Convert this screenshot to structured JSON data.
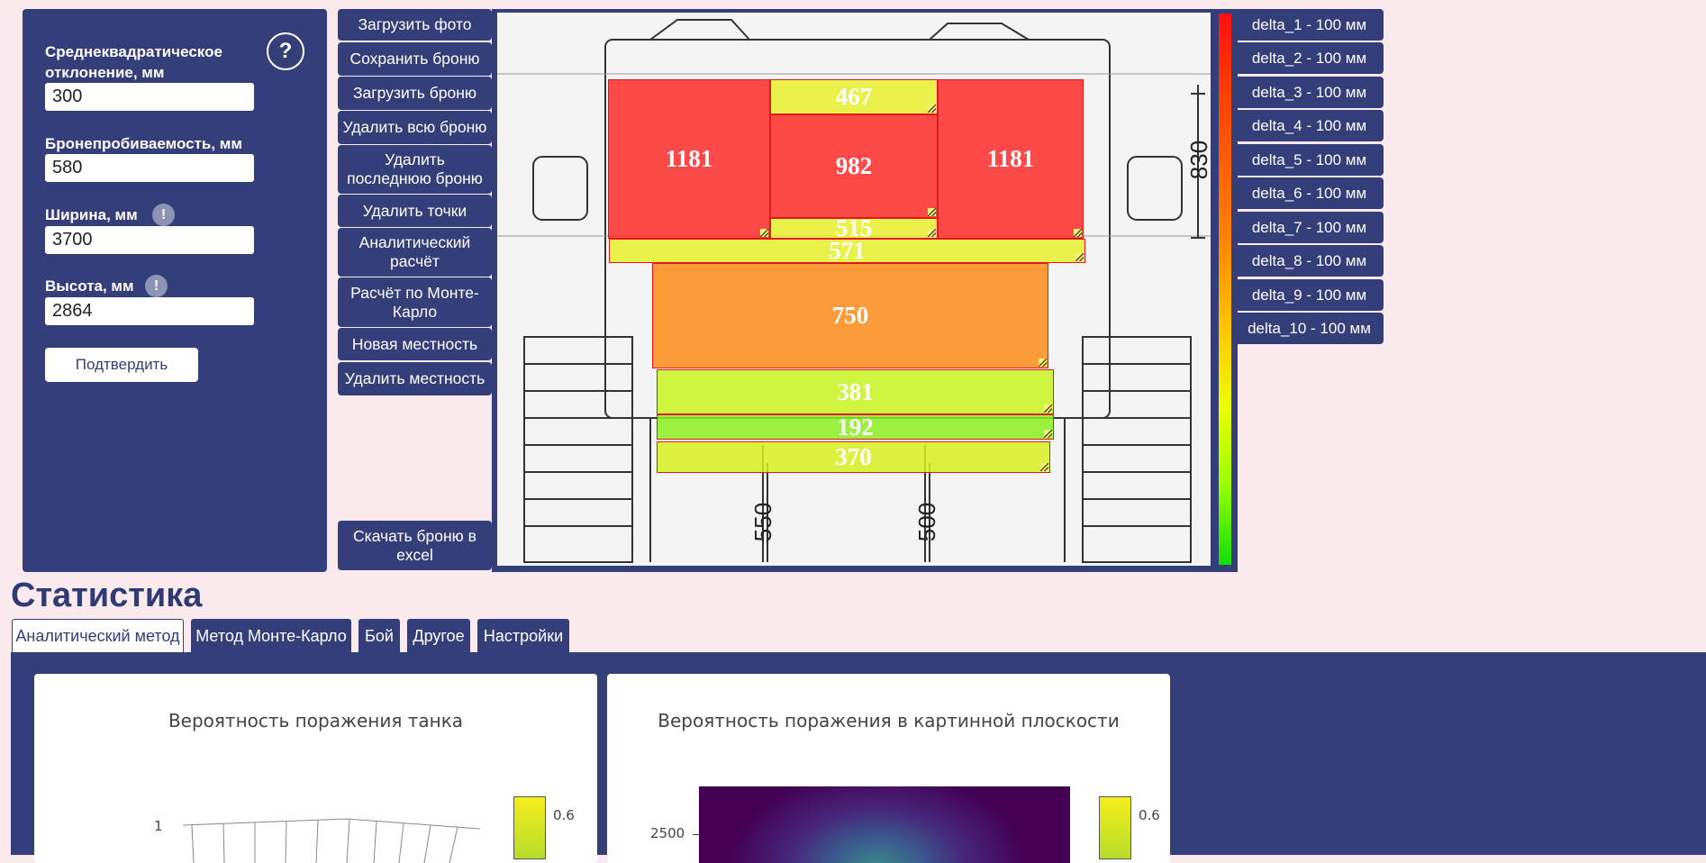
{
  "form": {
    "deviation_label": "Среднеквадратическое отклонение, мм",
    "deviation_value": "300",
    "penetration_label": "Бронепробиваемость, мм",
    "penetration_value": "580",
    "width_label": "Ширина, мм",
    "width_value": "3700",
    "height_label": "Высота, мм",
    "height_value": "2864",
    "help_glyph": "?",
    "info_glyph": "!",
    "confirm_label": "Подтвердить"
  },
  "actions": {
    "upload_photo": "Загрузить фото",
    "save_armor": "Сохранить броню",
    "load_armor": "Загрузить броню",
    "delete_all_armor": "Удалить всю броню",
    "delete_last_armor": "Удалить последнюю броню",
    "delete_points": "Удалить точки",
    "analytic_calc": "Аналитический расчёт",
    "monte_carlo_calc": "Расчёт по Монте-Карло",
    "new_terrain": "Новая местность",
    "delete_terrain": "Удалить местность",
    "download_excel": "Скачать броню в excel"
  },
  "armor_plates": [
    {
      "value": "467",
      "color": "#e8f020"
    },
    {
      "value": "1181",
      "color": "#ff2a2a"
    },
    {
      "value": "982",
      "color": "#ff2a2a"
    },
    {
      "value": "1181",
      "color": "#ff2a2a"
    },
    {
      "value": "515",
      "color": "#e8f020"
    },
    {
      "value": "571",
      "color": "#e8f020"
    },
    {
      "value": "750",
      "color": "#ff8c1a"
    },
    {
      "value": "381",
      "color": "#c8f520"
    },
    {
      "value": "192",
      "color": "#8cf020"
    },
    {
      "value": "370",
      "color": "#d8f020"
    }
  ],
  "drawing_dims": {
    "dim_830": "830",
    "dim_550": "550",
    "dim_500": "500"
  },
  "deltas": [
    "delta_1 - 100 мм",
    "delta_2 - 100 мм",
    "delta_3 - 100 мм",
    "delta_4 - 100 мм",
    "delta_5 - 100 мм",
    "delta_6 - 100 мм",
    "delta_7 - 100 мм",
    "delta_8 - 100 мм",
    "delta_9 - 100 мм",
    "delta_10 - 100 мм"
  ],
  "statistics": {
    "title": "Статистика",
    "tabs": [
      "Аналитический метод",
      "Метод Монте-Карло",
      "Бой",
      "Другое",
      "Настройки"
    ],
    "active_tab": "Аналитический метод",
    "chart1": {
      "title": "Вероятность поражения танка",
      "tick_y": "1",
      "colorbar_max": "0.6"
    },
    "chart2": {
      "title": "Вероятность поражения в картинной плоскости",
      "tick_y": "2500",
      "colorbar_max": "0.6"
    }
  },
  "colors": {
    "panel": "#343e78",
    "background": "#faeaee"
  }
}
